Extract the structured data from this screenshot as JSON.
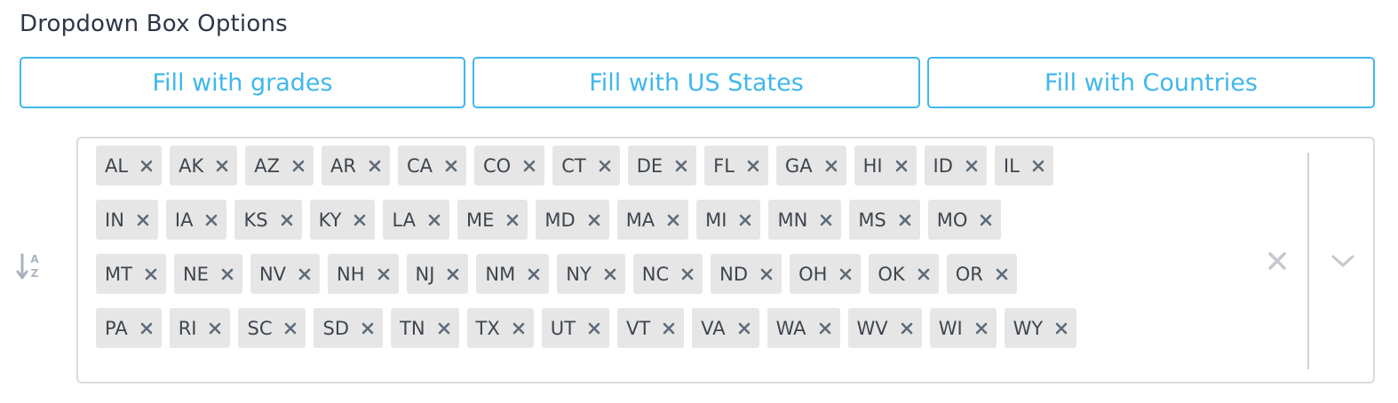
{
  "section": {
    "title": "Dropdown Box Options"
  },
  "buttons": {
    "grades": "Fill with grades",
    "us_states": "Fill with US States",
    "countries": "Fill with Countries"
  },
  "sort": {
    "icon": "sort-alpha-down-icon",
    "label_a": "A",
    "label_z": "Z"
  },
  "multiselect": {
    "selected": [
      "AL",
      "AK",
      "AZ",
      "AR",
      "CA",
      "CO",
      "CT",
      "DE",
      "FL",
      "GA",
      "HI",
      "ID",
      "IL",
      "IN",
      "IA",
      "KS",
      "KY",
      "LA",
      "ME",
      "MD",
      "MA",
      "MI",
      "MN",
      "MS",
      "MO",
      "MT",
      "NE",
      "NV",
      "NH",
      "NJ",
      "NM",
      "NY",
      "NC",
      "ND",
      "OH",
      "OK",
      "OR",
      "PA",
      "RI",
      "SC",
      "SD",
      "TN",
      "TX",
      "UT",
      "VT",
      "VA",
      "WA",
      "WV",
      "WI",
      "WY"
    ],
    "rows": [
      13,
      12,
      12,
      13
    ],
    "remove_icon": "close-icon",
    "clear_icon": "clear-all-icon",
    "toggle_icon": "chevron-down-icon"
  },
  "colors": {
    "accent": "#3fb7ec",
    "chip_bg": "#e6e6e6",
    "chip_text": "#3e454e",
    "chip_x": "#5d6b7a",
    "border": "#d9dbde",
    "muted_icon": "#c4c8cc"
  }
}
